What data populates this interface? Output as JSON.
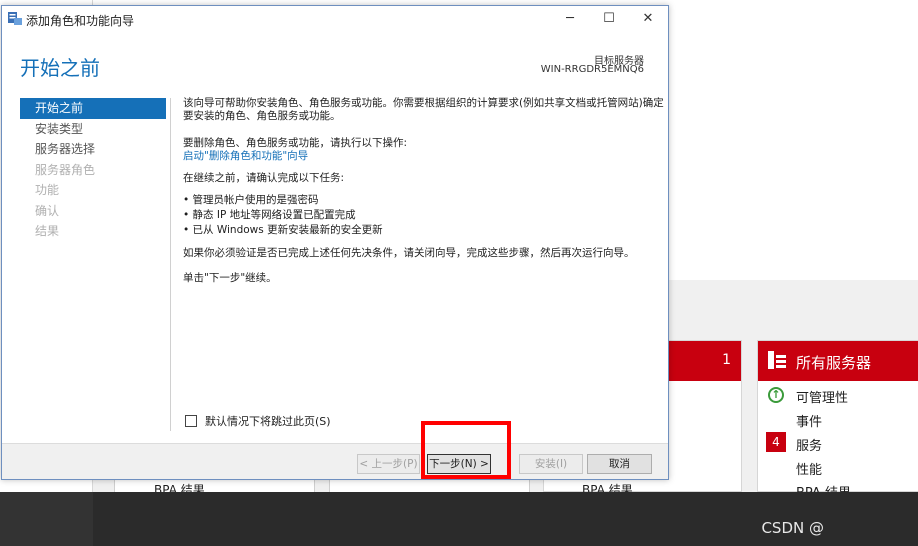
{
  "wizard": {
    "window_title": "添加角色和功能向导",
    "controls": {
      "minimize": "─",
      "maximize": "☐",
      "close": "✕"
    },
    "heading": "开始之前",
    "target_server_label": "目标服务器",
    "target_server_name": "WIN-RRGDR5EMNQ6",
    "nav": [
      {
        "label": "开始之前",
        "state": "active"
      },
      {
        "label": "安装类型",
        "state": "normal"
      },
      {
        "label": "服务器选择",
        "state": "normal"
      },
      {
        "label": "服务器角色",
        "state": "disabled"
      },
      {
        "label": "功能",
        "state": "disabled"
      },
      {
        "label": "确认",
        "state": "disabled"
      },
      {
        "label": "结果",
        "state": "disabled"
      }
    ],
    "content": {
      "intro_line1": "该向导可帮助你安装角色、角色服务或功能。你需要根据组织的计算要求(例如共享文档或托管网站)确定",
      "intro_line2": "要安装的角色、角色服务或功能。",
      "remove_line": "要删除角色、角色服务或功能，请执行以下操作:",
      "remove_link": "启动\"删除角色和功能\"向导",
      "before_line": "在继续之前，请确认完成以下任务:",
      "tasks": [
        "管理员帐户使用的是强密码",
        "静态 IP 地址等网络设置已配置完成",
        "已从 Windows 更新安装最新的安全更新"
      ],
      "verify_line": "如果你必须验证是否已完成上述任何先决条件，请关闭向导，完成这些步骤，然后再次运行向导。",
      "click_next": "单击\"下一步\"继续。"
    },
    "skip_checkbox_label": "默认情况下将跳过此页(S)",
    "buttons": {
      "previous": "< 上一步(P)",
      "next": "下一步(N) >",
      "install": "安装(I)",
      "cancel": "取消"
    }
  },
  "background": {
    "tile_count": "1",
    "all_servers_title": "所有服务器",
    "manageability": "可管理性",
    "events": "事件",
    "services_badge": "4",
    "services": "服务",
    "performance": "性能",
    "bpa_results": "BPA 结果"
  },
  "watermark": "CSDN @",
  "colors": {
    "accent": "#1570b8",
    "tile_red": "#c8000f",
    "highlight": "#ff0000"
  }
}
